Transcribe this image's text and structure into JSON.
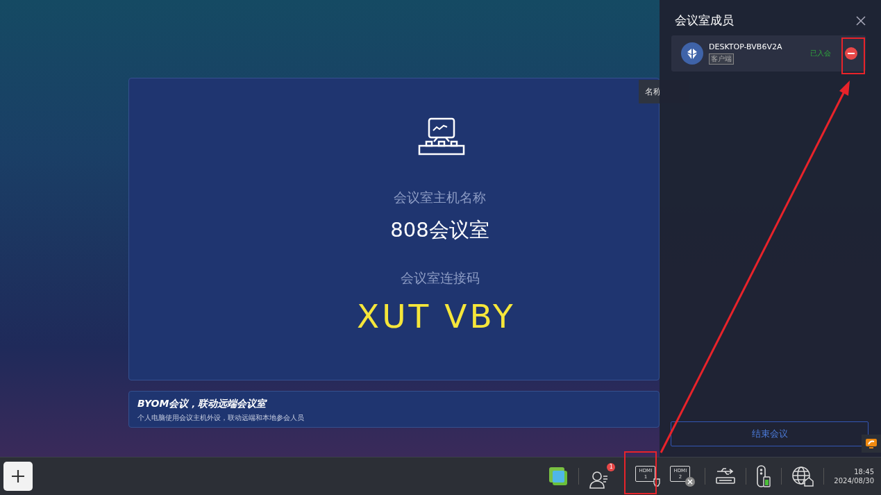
{
  "main_card": {
    "host_label": "会议室主机名称",
    "host_name": "808会议室",
    "code_label": "会议室连接码",
    "code": "XUT VBY"
  },
  "banner": {
    "title": "BYOM会议，联动远端会议室",
    "subtitle": "个人电脑使用会议主机外设，联动远端和本地参会人员"
  },
  "toast": {
    "text": "名称"
  },
  "members_panel": {
    "title": "会议室成员",
    "members": [
      {
        "name": "DESKTOP-BVB6V2A",
        "tag": "客户端",
        "status": "已入会",
        "joined": true
      }
    ],
    "end_button": "结束会议"
  },
  "taskbar": {
    "items": [
      {
        "kind": "windows"
      },
      {
        "kind": "members",
        "badge": "1"
      },
      {
        "kind": "hdmi",
        "label": "HDMI",
        "port": "1",
        "connected": true
      },
      {
        "kind": "hdmi",
        "label": "HDMI",
        "port": "2",
        "connected": false
      },
      {
        "kind": "usb"
      },
      {
        "kind": "remote"
      },
      {
        "kind": "network"
      }
    ],
    "time": "18:45",
    "date": "2024/08/30"
  }
}
